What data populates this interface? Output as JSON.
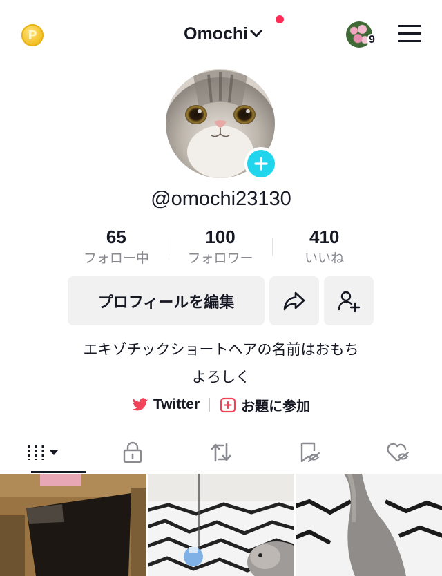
{
  "header": {
    "username": "Omochi",
    "coin_symbol": "P",
    "account_count": "9",
    "coin_icon": "coin-icon",
    "menu_icon": "hamburger-icon"
  },
  "profile": {
    "handle": "@omochi23130",
    "stats": [
      {
        "value": "65",
        "label": "フォロー中"
      },
      {
        "value": "100",
        "label": "フォロワー"
      },
      {
        "value": "410",
        "label": "いいね"
      }
    ],
    "edit_button": "プロフィールを編集",
    "bio_line1": "エキゾチックショートヘアの名前はおもち",
    "bio_line2": "よろしく",
    "links": {
      "twitter": "Twitter",
      "topic": "お題に参加"
    }
  },
  "tabs": [
    {
      "icon": "videos-grid-icon",
      "active": true
    },
    {
      "icon": "lock-icon",
      "active": false
    },
    {
      "icon": "repost-icon",
      "active": false
    },
    {
      "icon": "bookmark-icon",
      "active": false
    },
    {
      "icon": "liked-hidden-icon",
      "active": false
    }
  ],
  "colors": {
    "accent_red": "#fe2c55",
    "badge_cyan": "#20d5ec",
    "twitter_red": "#f0435a",
    "button_bg": "#f1f1f2"
  }
}
